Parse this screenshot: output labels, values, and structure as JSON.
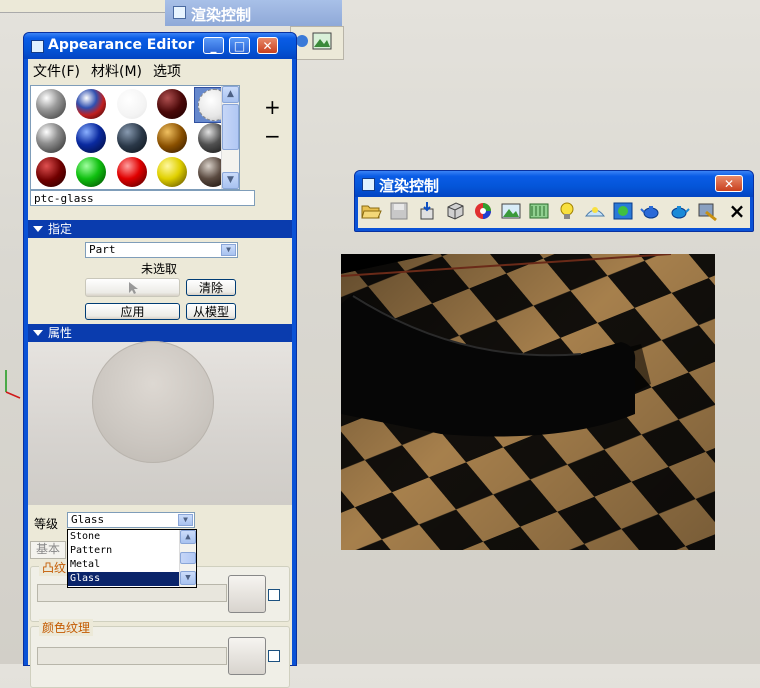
{
  "background_window": {
    "title": "渲染控制"
  },
  "appearance_editor": {
    "title": "Appearance Editor",
    "menu": {
      "file": "文件(F)",
      "material": "材料(M)",
      "options": "选项"
    },
    "plus_label": "+",
    "minus_label": "−",
    "current_appearance": "ptc-glass",
    "assign": {
      "header": "指定",
      "target": "Part",
      "status": "未选取",
      "clear": "清除",
      "apply": "应用",
      "from_model": "从模型"
    },
    "properties": {
      "header": "属性",
      "class_label": "等级",
      "class_value": "Glass",
      "class_options": [
        "Stone",
        "Pattern",
        "Metal",
        "Glass"
      ],
      "tab_basic": "基本",
      "group_bump": "凸纹",
      "group_color_texture": "颜色纹理"
    }
  },
  "render_control": {
    "title": "渲染控制",
    "tools": [
      "open-folder-icon",
      "save-icon",
      "import-icon",
      "cube-icon",
      "color-wheel-icon",
      "landscape-icon",
      "texture-icon",
      "light-bulb-icon",
      "sky-icon",
      "scene-icon",
      "teapot-icon",
      "teapot-render-icon",
      "wand-icon",
      "close-x-icon"
    ],
    "close_glyph": "×"
  },
  "colors": {
    "title_blue": "#0455d8",
    "section_blue": "#0a3cae",
    "window_face": "#ece9d8",
    "close_red": "#c8401e",
    "group_label": "#c45a00"
  }
}
